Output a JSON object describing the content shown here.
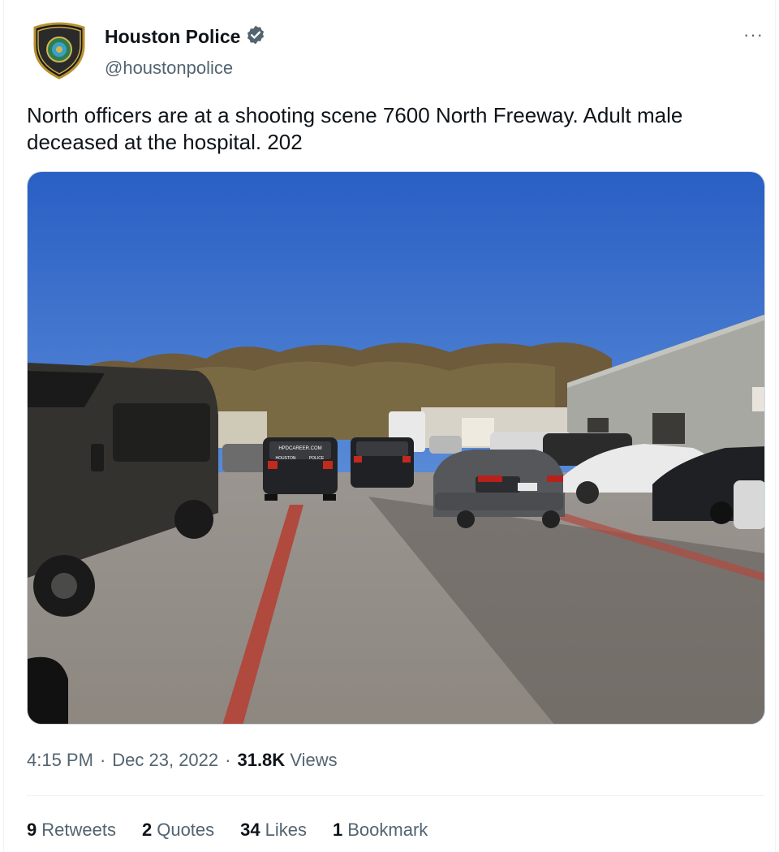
{
  "account": {
    "display_name": "Houston Police",
    "handle": "@houstonpolice",
    "avatar_icon": "houston-police-badge-icon",
    "avatar_lettering_top": "HOUSTON",
    "avatar_lettering_bottom": "POLICE",
    "verified_icon": "verified-badge-icon"
  },
  "menu": {
    "more_label": "···"
  },
  "tweet": {
    "text_line1": "North officers are at a shooting scene 7600 North Freeway. Adult male",
    "text_line2": "deceased at the hospital. 202"
  },
  "media": {
    "image": "parking-lot-police-vehicles-photo",
    "car_text": [
      "HPDCAREER.COM",
      "HOUSTON",
      "POLICE"
    ]
  },
  "meta": {
    "time": "4:15 PM",
    "separator": "·",
    "date": "Dec 23, 2022",
    "views_count": "31.8K",
    "views_label": "Views"
  },
  "stats": [
    {
      "count": "9",
      "label": "Retweets"
    },
    {
      "count": "2",
      "label": "Quotes"
    },
    {
      "count": "34",
      "label": "Likes"
    },
    {
      "count": "1",
      "label": "Bookmark"
    }
  ],
  "colors": {
    "primary_text": "#0f1419",
    "secondary_text": "#536471",
    "verified_blue": "#536471",
    "border": "#eff3f4"
  }
}
